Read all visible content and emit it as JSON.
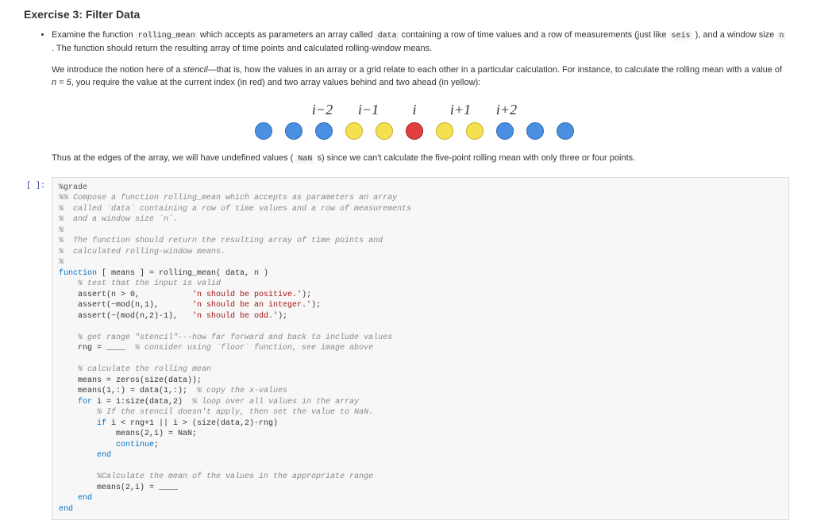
{
  "heading": "Exercise 3: Filter Data",
  "bullet_prefix": "Examine the function ",
  "fn_name": "rolling_mean",
  "bullet_mid1": " which accepts as parameters an array called ",
  "data_name": "data",
  "bullet_mid2": " containing a row of time values and a row of measurements (just like ",
  "seis_name": "seis",
  "bullet_mid3": " ), and a window size ",
  "n_name": "n",
  "bullet_end": " . The function should return the resulting array of time points and calculated rolling-window means.",
  "para1a": "We introduce the notion here of a ",
  "para1b": "stencil",
  "para1c": "—that is, how the values in an array or a grid relate to each other in a particular calculation. For instance, to calculate the rolling mean with a value of ",
  "para1d": "n = 5",
  "para1e": ", you require the value at the current index (in red) and two array values behind and two ahead (in yellow):",
  "labels": [
    "i−2",
    "i−1",
    "i",
    "i+1",
    "i+2"
  ],
  "para2a": "Thus at the edges of the array, we will have undefined values ( ",
  "nan": "NaN",
  "para2b": " s) since we can't calculate the five-point rolling mean with only three or four points.",
  "prompt": "[ ]:",
  "code": {
    "l01": "%grade",
    "l02": "%% Compose a function rolling_mean which accepts as parameters an array",
    "l03": "%  called `data` containing a row of time values and a row of measurements",
    "l04": "%  and a window size `n`.",
    "l05": "%",
    "l06": "%  The function should return the resulting array of time points and",
    "l07": "%  calculated rolling-window means.",
    "l08": "%",
    "l09a": "function",
    "l09b": " [ means ] = rolling_mean( data, n )",
    "l10": "    % test that the input is valid",
    "l11a": "    assert(n > 0,           ",
    "l11b": "'n should be positive.'",
    "l11c": ");",
    "l12a": "    assert(~mod(n,1),       ",
    "l12b": "'n should be an integer.'",
    "l12c": ");",
    "l13a": "    assert(~(mod(n,2)-1),   ",
    "l13b": "'n should be odd.'",
    "l13c": ");",
    "l14": "    % get range \"stencil\"---how far forward and back to include values",
    "l15a": "    rng = ____  ",
    "l15b": "% consider using `floor` function, see image above",
    "l16": "    % calculate the rolling mean",
    "l17": "    means = zeros(size(data));",
    "l18a": "    means(1,:) = data(1,:);  ",
    "l18b": "% copy the x-values",
    "l19a": "    for",
    "l19b": " i = 1:size(data,2)  ",
    "l19c": "% loop over all values in the array",
    "l20": "        % If the stencil doesn't apply, then set the value to NaN.",
    "l21a": "        if",
    "l21b": " i < rng+1 || i > (size(data,2)-rng)",
    "l22": "            means(2,i) = NaN;",
    "l23a": "            continue",
    "l23b": ";",
    "l24": "        end",
    "l25": "        %Calculate the mean of the values in the appropriate range",
    "l26": "        means(2,i) = ____",
    "l27": "    end",
    "l28": "end"
  }
}
